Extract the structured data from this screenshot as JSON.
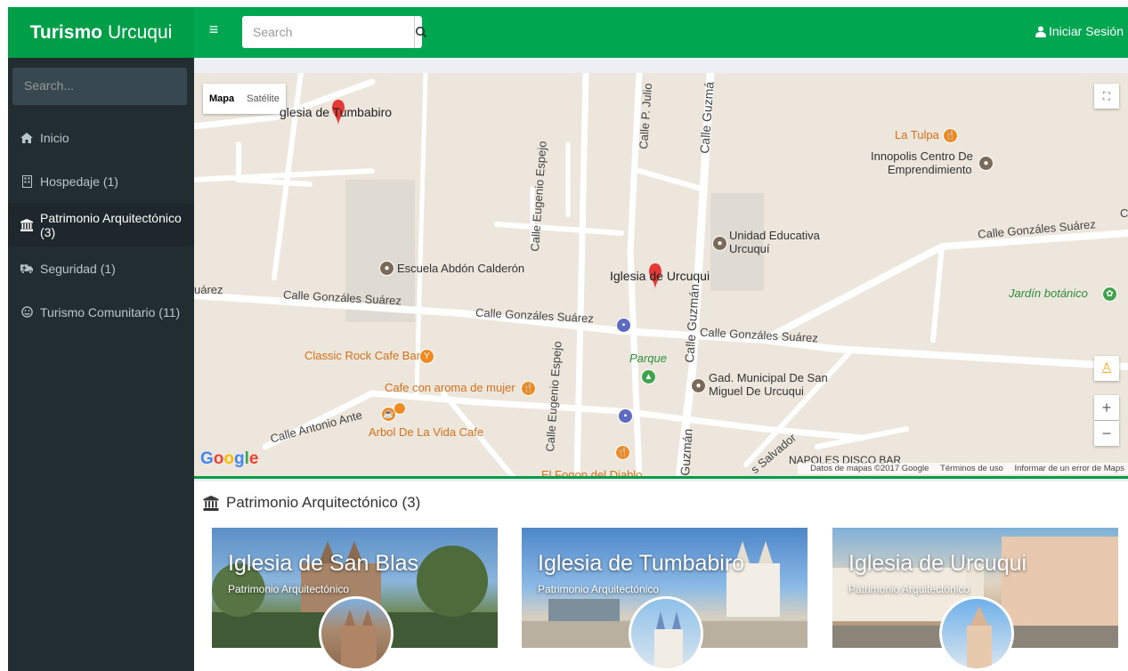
{
  "header": {
    "brand_bold": "Turismo",
    "brand_rest": "Urcuqui",
    "search_placeholder": "Search",
    "signin_label": "Iniciar Sesión"
  },
  "sidebar": {
    "search_placeholder": "Search...",
    "items": [
      {
        "label": "Inicio",
        "icon": "home-icon"
      },
      {
        "label": "Hospedaje (1)",
        "icon": "building-icon"
      },
      {
        "label": "Patrimonio Arquitectónico (3)",
        "icon": "bank-icon",
        "active": true
      },
      {
        "label": "Seguridad (1)",
        "icon": "ambulance-icon"
      },
      {
        "label": "Turismo Comunitario (11)",
        "icon": "smile-icon"
      }
    ]
  },
  "map": {
    "type_map": "Mapa",
    "type_satellite": "Satélite",
    "labels": {
      "iglesia_tumbabiro": "glesia de Tumbabiro",
      "la_tulpa": "La Tulpa",
      "innopolis": "Innopolis Centro De",
      "innopolis2": "Emprendimiento",
      "unidad": "Unidad Educativa",
      "unidad2": "Urcuquí",
      "escuela": "Escuela Abdón Calderón",
      "iglesia_urcuqui": "Iglesia de Urcuqui",
      "jardin": "Jardín botánico",
      "classic": "Classic Rock Cafe Bar",
      "cafe": "Cafe con aroma de mujer",
      "parque": "Parque",
      "gad": "Gad. Municipal De San",
      "gad2": "Miguel De Urcuqui",
      "arbol": "Arbol De La Vida Cafe",
      "fogon": "El Fogon del Diablo",
      "napoles": "NAPOLES DISCO BAR",
      "st_gs1": "Calle Gonzáles Suárez",
      "st_gs2": "Calle Gonzáles Suárez",
      "st_gs3": "Calle Gonzáles Suárez",
      "st_gs4": "Calle Gonzáles Suárez",
      "st_uarez": "uárez",
      "st_antonio": "Calle Antonio Ante",
      "st_espejo1": "Calle Eugenio Espejo",
      "st_espejo2": "Calle Eugenio Espejo",
      "st_julio": "Calle P. Julio",
      "st_guzman1": "Calle Guzmá",
      "st_guzman2": "Calle Guzmán",
      "st_guzman3": "Guzmán",
      "st_salvador": "s Salvador",
      "st_c": "C"
    },
    "google": "Google",
    "attribution": "Datos de mapas ©2017 Google",
    "terms": "Términos de uso",
    "report": "Informar de un error de Maps"
  },
  "section": {
    "title": "Patrimonio Arquitectónico (3)",
    "cards": [
      {
        "title": "Iglesia de San Blas",
        "subtitle": "Patrimonio Arquitectónico"
      },
      {
        "title": "Iglesia de Tumbabiro",
        "subtitle": "Patrimonio Arquitectónico"
      },
      {
        "title": "Iglesia de Urcuqui",
        "subtitle": "Patrimonio Arquitectónico"
      }
    ]
  },
  "colors": {
    "brand": "#00a650",
    "sidebar": "#222d32",
    "marker": "#e53935",
    "poi_orange": "#ef8a21"
  }
}
